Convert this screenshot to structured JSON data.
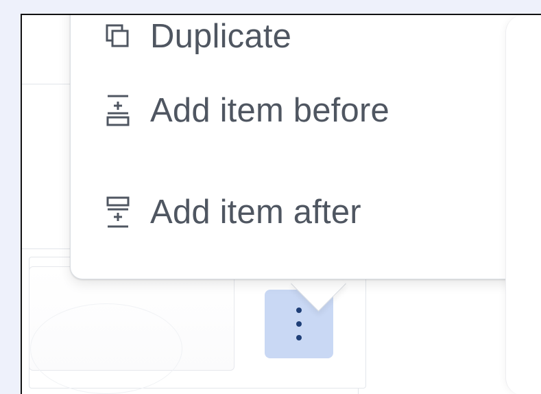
{
  "menu": {
    "items": [
      {
        "label": "Duplicate",
        "icon": "duplicate-icon"
      },
      {
        "label": "Add item before",
        "icon": "add-item-before-icon"
      },
      {
        "label": "Add item after",
        "icon": "add-item-after-icon"
      }
    ]
  },
  "colors": {
    "background": "#eef1fb",
    "menu_text": "#4f5661",
    "kebab_button_bg": "#c9d8f4",
    "kebab_dot": "#1f3f77"
  },
  "icons": {
    "kebab": "more-vertical-icon"
  }
}
